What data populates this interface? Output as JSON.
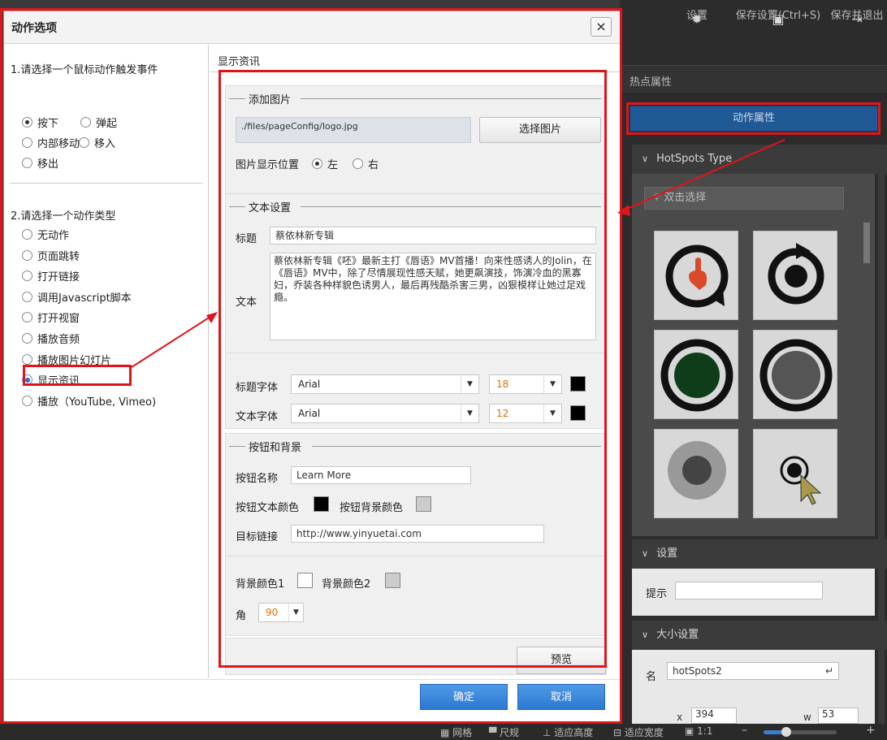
{
  "toolbar": {
    "settings_label": "设置",
    "save_label": "保存设置(Ctrl+S)",
    "save_exit_label": "保存并退出"
  },
  "right_panel": {
    "hotspot_props": "热点属性",
    "action_props_button": "动作属性",
    "hotspots_type_header": "HotSpots Type",
    "dblclick_select": "双击选择",
    "settings_header": "设置",
    "hint_label": "提示",
    "size_header": "大小设置",
    "name_label": "名",
    "name_value": "hotSpots2",
    "x_label": "x",
    "x_value": "394",
    "w_label": "w",
    "w_value": "53"
  },
  "statusbar": {
    "grid": "网格",
    "ruler": "尺规",
    "fit_height": "适应高度",
    "fit_width": "适应宽度",
    "ratio": "1:1",
    "minus": "–",
    "plus": "+"
  },
  "dialog": {
    "title": "动作选项",
    "close": "×",
    "left": {
      "step1": "1.请选择一个鼠标动作触发事件",
      "triggers": [
        {
          "label": "按下",
          "selected": true
        },
        {
          "label": "弹起",
          "selected": false
        },
        {
          "label": "内部移动",
          "selected": false
        },
        {
          "label": "移入",
          "selected": false
        },
        {
          "label": "移出",
          "selected": false
        }
      ],
      "step2": "2.请选择一个动作类型",
      "actions": [
        {
          "label": "无动作",
          "selected": false
        },
        {
          "label": "页面跳转",
          "selected": false
        },
        {
          "label": "打开链接",
          "selected": false
        },
        {
          "label": "调用Javascript脚本",
          "selected": false
        },
        {
          "label": "打开视窗",
          "selected": false
        },
        {
          "label": "播放音频",
          "selected": false
        },
        {
          "label": "播放图片幻灯片",
          "selected": false
        },
        {
          "label": "显示资讯",
          "selected": true
        },
        {
          "label": "播放（YouTube, Vimeo)",
          "selected": false
        }
      ]
    },
    "right": {
      "header": "显示资讯",
      "add_image": {
        "legend": "添加图片",
        "path": "./files/pageConfig/logo.jpg",
        "choose_button": "选择图片",
        "position_label": "图片显示位置",
        "left_option": "左",
        "right_option": "右"
      },
      "text_settings": {
        "legend": "文本设置",
        "title_label": "标题",
        "title_value": "蔡依林新专辑",
        "text_label": "文本",
        "text_value": "蔡依林新专辑《呸》最新主打《唇语》MV首播！向来性感诱人的Jolin，在《唇语》MV中，除了尽情展现性感天赋，她更飙演技，饰演冷血的黑寡妇，乔装各种样貌色诱男人，最后再残酷杀害三男，凶狠模样让她过足戏瘾。",
        "title_font_label": "标题字体",
        "title_font": "Arial",
        "title_size": "18",
        "text_font_label": "文本字体",
        "text_font": "Arial",
        "text_size": "12"
      },
      "button_bg": {
        "legend": "按钮和背景",
        "button_name_label": "按钮名称",
        "button_name": "Learn More",
        "btn_text_color_label": "按钮文本颜色",
        "btn_bg_color_label": "按钮背景颜色",
        "target_link_label": "目标链接",
        "target_link": "http://www.yinyuetai.com",
        "bg_color1_label": "背景颜色1",
        "bg_color2_label": "背景颜色2",
        "angle_label": "角",
        "angle_value": "90",
        "preview_button": "预览"
      }
    },
    "ok_button": "确定",
    "cancel_button": "取消"
  },
  "colors": {
    "accent_red": "#e0141b",
    "orange_value": "#e07000",
    "blue_button": "#2b78d2",
    "action_btn_blue": "#1f5a94"
  }
}
